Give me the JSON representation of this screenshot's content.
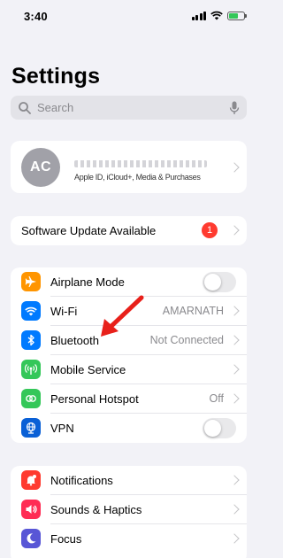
{
  "status": {
    "time": "3:40"
  },
  "header": {
    "title": "Settings"
  },
  "search": {
    "placeholder": "Search"
  },
  "profile": {
    "initials": "AC",
    "subtitle": "Apple ID, iCloud+, Media & Purchases"
  },
  "update": {
    "label": "Software Update Available",
    "badge": "1"
  },
  "connectivity": [
    {
      "label": "Airplane Mode",
      "value": "",
      "color": "#ff9500",
      "icon": "airplane-icon",
      "toggle": true
    },
    {
      "label": "Wi-Fi",
      "value": "AMARNATH",
      "color": "#007aff",
      "icon": "wifi-icon"
    },
    {
      "label": "Bluetooth",
      "value": "Not Connected",
      "color": "#007aff",
      "icon": "bluetooth-icon"
    },
    {
      "label": "Mobile Service",
      "value": "",
      "color": "#34c759",
      "icon": "antenna-icon"
    },
    {
      "label": "Personal Hotspot",
      "value": "Off",
      "color": "#34c759",
      "icon": "hotspot-icon"
    },
    {
      "label": "VPN",
      "value": "",
      "color": "#0a60d6",
      "icon": "globe-icon",
      "toggle": true
    }
  ],
  "notifications": [
    {
      "label": "Notifications",
      "color": "#ff3b30",
      "icon": "bell-icon"
    },
    {
      "label": "Sounds & Haptics",
      "color": "#ff2d55",
      "icon": "speaker-icon"
    },
    {
      "label": "Focus",
      "color": "#5856d6",
      "icon": "moon-icon"
    }
  ],
  "annotation": {
    "arrow_color": "#e8201a"
  }
}
